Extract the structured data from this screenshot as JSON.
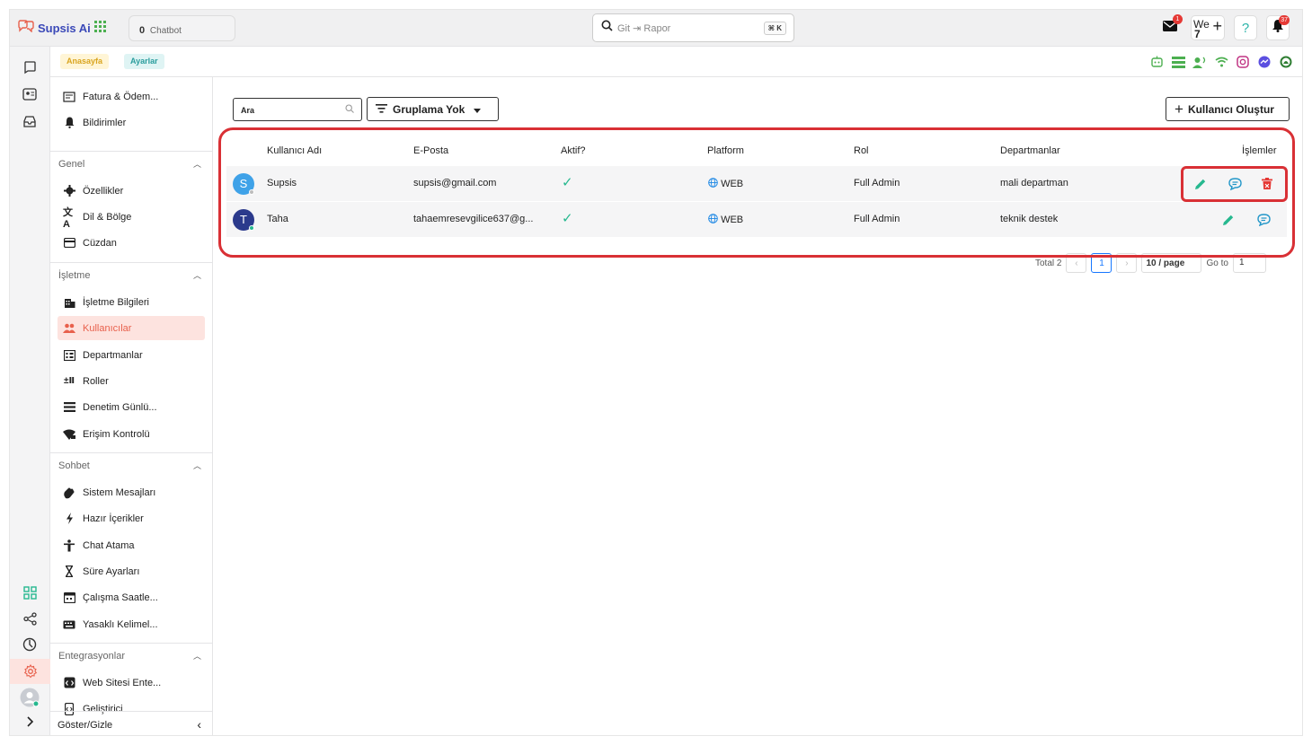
{
  "app": {
    "name": "Supsis Ai"
  },
  "topbar": {
    "chatbot_count": "0",
    "chatbot_label": "Chatbot",
    "search_placeholder": "Git ⇥ Rapor",
    "search_shortcut": "⌘ K",
    "mail_badge": "1",
    "lang_top": "We",
    "lang_bottom": "7",
    "help_label": "?",
    "notif_badge": "37"
  },
  "breadcrumbs": [
    {
      "label": "Anasayfa"
    },
    {
      "label": "Ayarlar"
    }
  ],
  "sidebar": {
    "top_items": [
      {
        "label": "Fatura & Ödem..."
      },
      {
        "label": "Bildirimler"
      }
    ],
    "sections": [
      {
        "title": "Genel",
        "items": [
          {
            "label": "Özellikler"
          },
          {
            "label": "Dil & Bölge"
          },
          {
            "label": "Cüzdan"
          }
        ]
      },
      {
        "title": "İşletme",
        "items": [
          {
            "label": "İşletme Bilgileri"
          },
          {
            "label": "Kullanıcılar"
          },
          {
            "label": "Departmanlar"
          },
          {
            "label": "Roller"
          },
          {
            "label": "Denetim Günlü..."
          },
          {
            "label": "Erişim Kontrolü"
          }
        ]
      },
      {
        "title": "Sohbet",
        "items": [
          {
            "label": "Sistem Mesajları"
          },
          {
            "label": "Hazır İçerikler"
          },
          {
            "label": "Chat Atama"
          },
          {
            "label": "Süre Ayarları"
          },
          {
            "label": "Çalışma Saatle..."
          },
          {
            "label": "Yasaklı Kelimel..."
          }
        ]
      },
      {
        "title": "Entegrasyonlar",
        "items": [
          {
            "label": "Web Sitesi Ente..."
          },
          {
            "label": "Geliştirici"
          }
        ]
      }
    ],
    "footer_label": "Göster/Gizle"
  },
  "main": {
    "search_value": "Ara",
    "group_button": "Gruplama Yok",
    "create_button": "Kullanıcı Oluştur",
    "table": {
      "columns": [
        "Kullanıcı Adı",
        "E-Posta",
        "Aktif?",
        "Platform",
        "Rol",
        "Departmanlar",
        "İşlemler"
      ],
      "rows": [
        {
          "initial": "S",
          "name": "Supsis",
          "email": "supsis@gmail.com",
          "active": "✓",
          "platform": "WEB",
          "role": "Full Admin",
          "department": "mali departman"
        },
        {
          "initial": "T",
          "name": "Taha",
          "email": "tahaemresevgilice637@g...",
          "active": "✓",
          "platform": "WEB",
          "role": "Full Admin",
          "department": "teknik destek"
        }
      ]
    },
    "pagination": {
      "total": "Total 2",
      "prev": "‹",
      "current": "1",
      "next": "›",
      "page_size": "10 / page",
      "goto_label": "Go to",
      "goto_value": "1"
    }
  },
  "colors": {
    "accent": "#e8604c",
    "highlight": "#d93035",
    "brand": "#3b49b8",
    "edit": "#26b88f",
    "chat": "#2196c8",
    "delete": "#e53935"
  }
}
